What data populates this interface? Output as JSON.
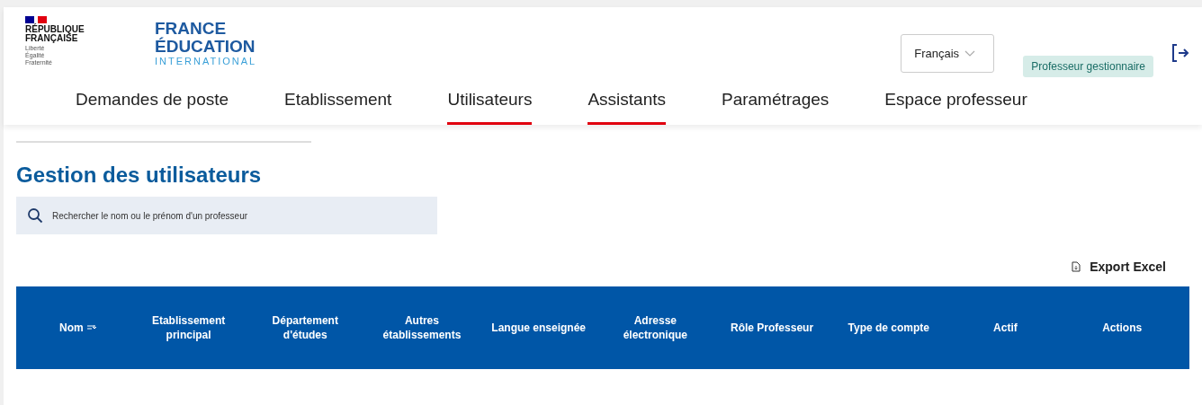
{
  "header": {
    "marianne": {
      "line1": "RÉPUBLIQUE",
      "line2": "FRANÇAISE",
      "motto": [
        "Liberté",
        "Égalité",
        "Fraternité"
      ]
    },
    "brand": {
      "line1": "FRANCE",
      "line2": "ÉDUCATION",
      "line3": "INTERNATIONAL"
    },
    "language": "Français",
    "role_badge": "Professeur gestionnaire"
  },
  "nav": [
    {
      "label": "Demandes de poste",
      "selected": false
    },
    {
      "label": "Etablissement",
      "selected": false
    },
    {
      "label": "Utilisateurs",
      "selected": true
    },
    {
      "label": "Assistants",
      "selected": true
    },
    {
      "label": "Paramétrages",
      "selected": false
    },
    {
      "label": "Espace professeur",
      "selected": false
    }
  ],
  "page_title": "Gestion des utilisateurs",
  "search": {
    "placeholder": "Rechercher le nom ou le prénom d'un professeur"
  },
  "export_button": "Export Excel",
  "table": {
    "columns": [
      {
        "label": "Nom",
        "sortable": true
      },
      {
        "label": "Etablissement principal",
        "sortable": false
      },
      {
        "label": "Département d'études",
        "sortable": false
      },
      {
        "label": "Autres établissements",
        "sortable": false
      },
      {
        "label": "Langue enseignée",
        "sortable": false
      },
      {
        "label": "Adresse électronique",
        "sortable": false
      },
      {
        "label": "Rôle Professeur",
        "sortable": false
      },
      {
        "label": "Type de compte",
        "sortable": false
      },
      {
        "label": "Actif",
        "sortable": false
      },
      {
        "label": "Actions",
        "sortable": false
      }
    ]
  }
}
